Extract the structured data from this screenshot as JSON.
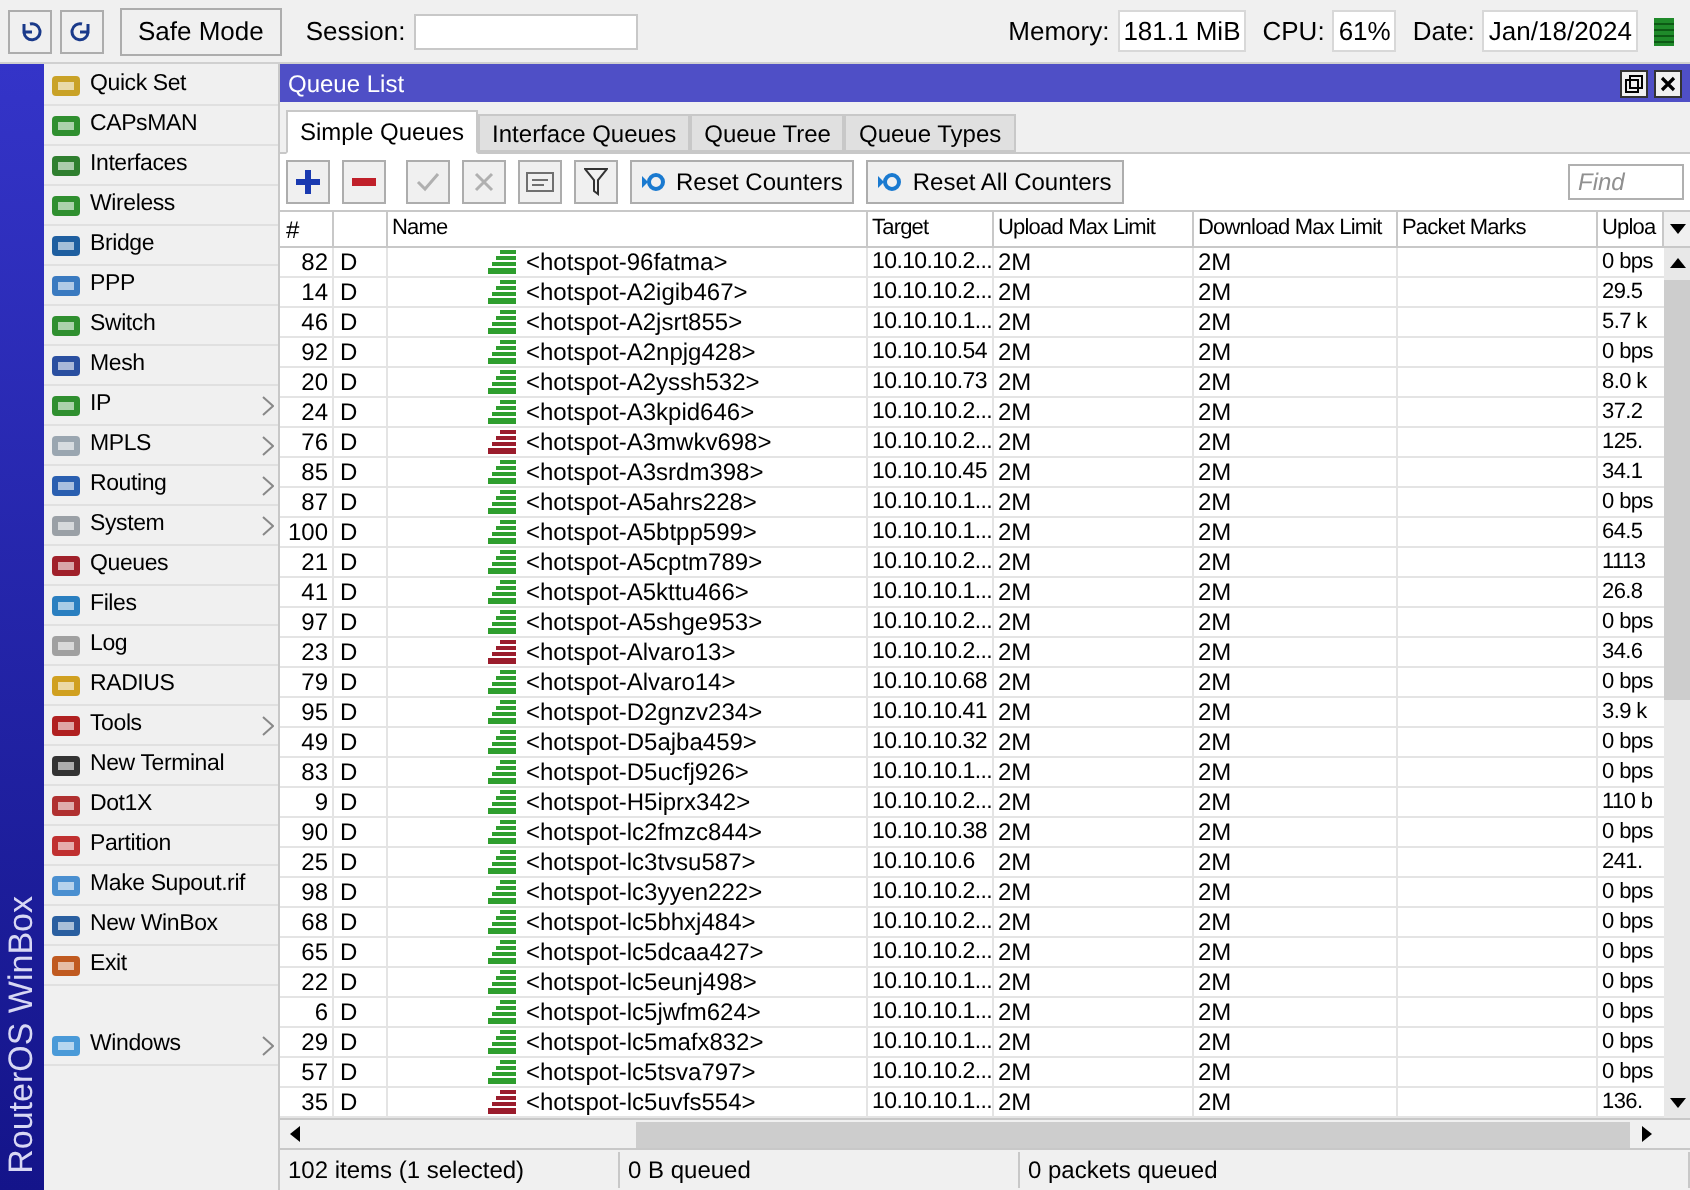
{
  "top_bar": {
    "safe_mode": "Safe Mode",
    "session_label": "Session:",
    "memory_label": "Memory:",
    "memory": "181.1 MiB",
    "cpu_label": "CPU:",
    "cpu": "61%",
    "date_label": "Date:",
    "date": "Jan/18/2024"
  },
  "sidebar": {
    "brand": "RouterOS WinBox",
    "items": [
      {
        "label": "Quick Set",
        "submenu": false
      },
      {
        "label": "CAPsMAN",
        "submenu": false
      },
      {
        "label": "Interfaces",
        "submenu": false
      },
      {
        "label": "Wireless",
        "submenu": false
      },
      {
        "label": "Bridge",
        "submenu": false
      },
      {
        "label": "PPP",
        "submenu": false
      },
      {
        "label": "Switch",
        "submenu": false
      },
      {
        "label": "Mesh",
        "submenu": false
      },
      {
        "label": "IP",
        "submenu": true
      },
      {
        "label": "MPLS",
        "submenu": true
      },
      {
        "label": "Routing",
        "submenu": true
      },
      {
        "label": "System",
        "submenu": true
      },
      {
        "label": "Queues",
        "submenu": false
      },
      {
        "label": "Files",
        "submenu": false
      },
      {
        "label": "Log",
        "submenu": false
      },
      {
        "label": "RADIUS",
        "submenu": false
      },
      {
        "label": "Tools",
        "submenu": true
      },
      {
        "label": "New Terminal",
        "submenu": false
      },
      {
        "label": "Dot1X",
        "submenu": false
      },
      {
        "label": "Partition",
        "submenu": false
      },
      {
        "label": "Make Supout.rif",
        "submenu": false
      },
      {
        "label": "New WinBox",
        "submenu": false
      },
      {
        "label": "Exit",
        "submenu": false
      },
      {
        "label": "Windows",
        "submenu": true,
        "separated": true
      }
    ]
  },
  "window": {
    "title": "Queue List",
    "tabs": [
      {
        "label": "Simple Queues",
        "selected": true
      },
      {
        "label": "Interface Queues",
        "selected": false
      },
      {
        "label": "Queue Tree",
        "selected": false
      },
      {
        "label": "Queue Types",
        "selected": false
      }
    ],
    "toolbar": {
      "reset_counters": "Reset Counters",
      "reset_all_counters": "Reset All Counters",
      "find_placeholder": "Find"
    },
    "table": {
      "columns": [
        "#",
        "Name",
        "Target",
        "Upload Max Limit",
        "Download Max Limit",
        "Packet Marks",
        "Uploa"
      ],
      "rows": [
        {
          "num": "82",
          "flag": "D",
          "name": "<hotspot-96fatma>",
          "target": "10.10.10.2...",
          "upload_max": "2M",
          "download_max": "2M",
          "upload": "0 bps",
          "color": "#2e9e2e"
        },
        {
          "num": "14",
          "flag": "D",
          "name": "<hotspot-A2igib467>",
          "target": "10.10.10.2...",
          "upload_max": "2M",
          "download_max": "2M",
          "upload": "29.5",
          "color": "#2e9e2e"
        },
        {
          "num": "46",
          "flag": "D",
          "name": "<hotspot-A2jsrt855>",
          "target": "10.10.10.1...",
          "upload_max": "2M",
          "download_max": "2M",
          "upload": "5.7 k",
          "color": "#2e9e2e"
        },
        {
          "num": "92",
          "flag": "D",
          "name": "<hotspot-A2npjg428>",
          "target": "10.10.10.54",
          "upload_max": "2M",
          "download_max": "2M",
          "upload": "0 bps",
          "color": "#2e9e2e"
        },
        {
          "num": "20",
          "flag": "D",
          "name": "<hotspot-A2yssh532>",
          "target": "10.10.10.73",
          "upload_max": "2M",
          "download_max": "2M",
          "upload": "8.0 k",
          "color": "#2e9e2e"
        },
        {
          "num": "24",
          "flag": "D",
          "name": "<hotspot-A3kpid646>",
          "target": "10.10.10.2...",
          "upload_max": "2M",
          "download_max": "2M",
          "upload": "37.2",
          "color": "#2e9e2e"
        },
        {
          "num": "76",
          "flag": "D",
          "name": "<hotspot-A3mwkv698>",
          "target": "10.10.10.2...",
          "upload_max": "2M",
          "download_max": "2M",
          "upload": "125.",
          "color": "#9a1c2c"
        },
        {
          "num": "85",
          "flag": "D",
          "name": "<hotspot-A3srdm398>",
          "target": "10.10.10.45",
          "upload_max": "2M",
          "download_max": "2M",
          "upload": "34.1",
          "color": "#2e9e2e"
        },
        {
          "num": "87",
          "flag": "D",
          "name": "<hotspot-A5ahrs228>",
          "target": "10.10.10.1...",
          "upload_max": "2M",
          "download_max": "2M",
          "upload": "0 bps",
          "color": "#2e9e2e"
        },
        {
          "num": "100",
          "flag": "D",
          "name": "<hotspot-A5btpp599>",
          "target": "10.10.10.1...",
          "upload_max": "2M",
          "download_max": "2M",
          "upload": "64.5",
          "color": "#2e9e2e"
        },
        {
          "num": "21",
          "flag": "D",
          "name": "<hotspot-A5cptm789>",
          "target": "10.10.10.2...",
          "upload_max": "2M",
          "download_max": "2M",
          "upload": "1113",
          "color": "#2e9e2e"
        },
        {
          "num": "41",
          "flag": "D",
          "name": "<hotspot-A5kttu466>",
          "target": "10.10.10.1...",
          "upload_max": "2M",
          "download_max": "2M",
          "upload": "26.8",
          "color": "#2e9e2e"
        },
        {
          "num": "97",
          "flag": "D",
          "name": "<hotspot-A5shge953>",
          "target": "10.10.10.2...",
          "upload_max": "2M",
          "download_max": "2M",
          "upload": "0 bps",
          "color": "#2e9e2e"
        },
        {
          "num": "23",
          "flag": "D",
          "name": "<hotspot-Alvaro13>",
          "target": "10.10.10.2...",
          "upload_max": "2M",
          "download_max": "2M",
          "upload": "34.6",
          "color": "#9a1c2c"
        },
        {
          "num": "79",
          "flag": "D",
          "name": "<hotspot-Alvaro14>",
          "target": "10.10.10.68",
          "upload_max": "2M",
          "download_max": "2M",
          "upload": "0 bps",
          "color": "#2e9e2e"
        },
        {
          "num": "95",
          "flag": "D",
          "name": "<hotspot-D2gnzv234>",
          "target": "10.10.10.41",
          "upload_max": "2M",
          "download_max": "2M",
          "upload": "3.9 k",
          "color": "#2e9e2e"
        },
        {
          "num": "49",
          "flag": "D",
          "name": "<hotspot-D5ajba459>",
          "target": "10.10.10.32",
          "upload_max": "2M",
          "download_max": "2M",
          "upload": "0 bps",
          "color": "#2e9e2e"
        },
        {
          "num": "83",
          "flag": "D",
          "name": "<hotspot-D5ucfj926>",
          "target": "10.10.10.1...",
          "upload_max": "2M",
          "download_max": "2M",
          "upload": "0 bps",
          "color": "#2e9e2e"
        },
        {
          "num": "9",
          "flag": "D",
          "name": "<hotspot-H5iprx342>",
          "target": "10.10.10.2...",
          "upload_max": "2M",
          "download_max": "2M",
          "upload": "110 b",
          "color": "#2e9e2e"
        },
        {
          "num": "90",
          "flag": "D",
          "name": "<hotspot-lc2fmzc844>",
          "target": "10.10.10.38",
          "upload_max": "2M",
          "download_max": "2M",
          "upload": "0 bps",
          "color": "#2e9e2e"
        },
        {
          "num": "25",
          "flag": "D",
          "name": "<hotspot-lc3tvsu587>",
          "target": "10.10.10.6",
          "upload_max": "2M",
          "download_max": "2M",
          "upload": "241.",
          "color": "#2e9e2e"
        },
        {
          "num": "98",
          "flag": "D",
          "name": "<hotspot-lc3yyen222>",
          "target": "10.10.10.2...",
          "upload_max": "2M",
          "download_max": "2M",
          "upload": "0 bps",
          "color": "#2e9e2e"
        },
        {
          "num": "68",
          "flag": "D",
          "name": "<hotspot-lc5bhxj484>",
          "target": "10.10.10.2...",
          "upload_max": "2M",
          "download_max": "2M",
          "upload": "0 bps",
          "color": "#2e9e2e"
        },
        {
          "num": "65",
          "flag": "D",
          "name": "<hotspot-lc5dcaa427>",
          "target": "10.10.10.2...",
          "upload_max": "2M",
          "download_max": "2M",
          "upload": "0 bps",
          "color": "#2e9e2e"
        },
        {
          "num": "22",
          "flag": "D",
          "name": "<hotspot-lc5eunj498>",
          "target": "10.10.10.1...",
          "upload_max": "2M",
          "download_max": "2M",
          "upload": "0 bps",
          "color": "#2e9e2e"
        },
        {
          "num": "6",
          "flag": "D",
          "name": "<hotspot-lc5jwfm624>",
          "target": "10.10.10.1...",
          "upload_max": "2M",
          "download_max": "2M",
          "upload": "0 bps",
          "color": "#2e9e2e"
        },
        {
          "num": "29",
          "flag": "D",
          "name": "<hotspot-lc5mafx832>",
          "target": "10.10.10.1...",
          "upload_max": "2M",
          "download_max": "2M",
          "upload": "0 bps",
          "color": "#2e9e2e"
        },
        {
          "num": "57",
          "flag": "D",
          "name": "<hotspot-lc5tsva797>",
          "target": "10.10.10.2...",
          "upload_max": "2M",
          "download_max": "2M",
          "upload": "0 bps",
          "color": "#2e9e2e"
        },
        {
          "num": "35",
          "flag": "D",
          "name": "<hotspot-lc5uvfs554>",
          "target": "10.10.10.1...",
          "upload_max": "2M",
          "download_max": "2M",
          "upload": "136.",
          "color": "#9a1c2c"
        }
      ]
    },
    "status_bar": [
      "102 items (1 selected)",
      "0 B queued",
      "0 packets queued"
    ]
  }
}
